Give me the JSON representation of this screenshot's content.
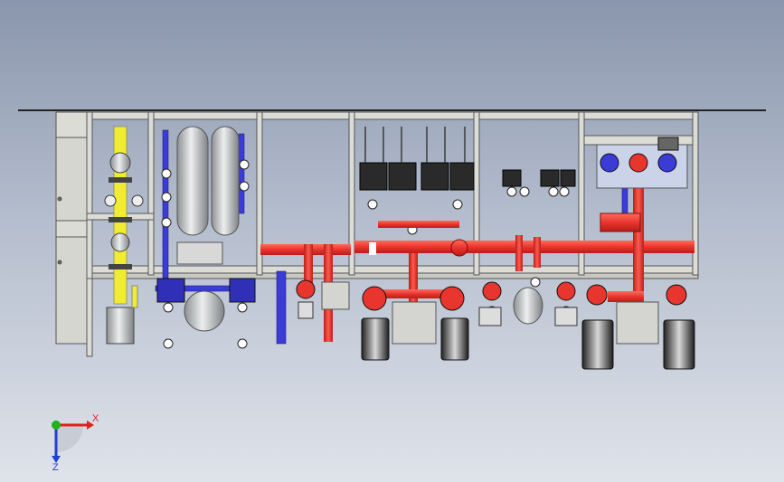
{
  "viewport": {
    "background_top": "#8a96ad",
    "background_bottom": "#dfe3ea"
  },
  "colors": {
    "frame": "#dcdcd6",
    "frame_edge": "#555555",
    "pipe_red": "#e8352e",
    "pipe_blue": "#3b3bd6",
    "pipe_yellow": "#f2ec2e",
    "steel": "#c4c6c8",
    "motor_dark": "#2a2a2a",
    "axis_x": "#e02020",
    "axis_y": "#20b020",
    "axis_z": "#2040d0"
  },
  "triad": {
    "x_label": "X",
    "z_label": "Z",
    "origin_icon": "coordinate-triad-icon"
  }
}
